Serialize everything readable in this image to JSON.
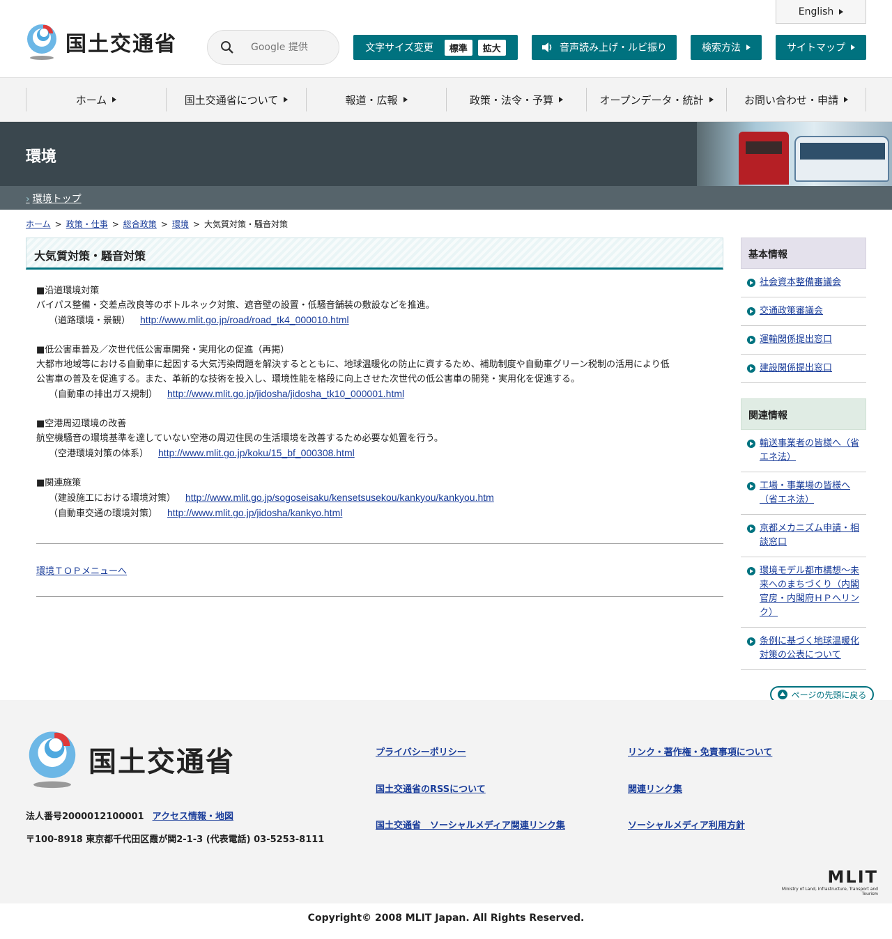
{
  "header": {
    "logo_text": "国土交通省",
    "search_placeholder": "Google 提供",
    "english_label": "English",
    "fontsize_label": "文字サイズ変更",
    "fontsize_standard": "標準",
    "fontsize_large": "拡大",
    "voice_label": "音声読み上げ・ルビ振り",
    "howto_label": "検索方法",
    "sitemap_label": "サイトマップ"
  },
  "gnav": [
    "ホーム",
    "国土交通省について",
    "報道・広報",
    "政策・法令・予算",
    "オープンデータ・統計",
    "お問い合わせ・申請"
  ],
  "banner": {
    "title": "環境",
    "subnav_link": "環境トップ"
  },
  "breadcrumb": [
    "ホーム",
    "政策・仕事",
    "総合政策",
    "環境"
  ],
  "breadcrumb_current": "大気質対策・騒音対策",
  "main": {
    "title": "大気質対策・騒音対策",
    "block1": {
      "heading": "■沿道環境対策",
      "text": "バイパス整備・交差点改良等のボトルネック対策、遮音壁の設置・低騒音舗装の敷設などを推進。",
      "ref_label": "（道路環境・景観）",
      "ref_url": "http://www.mlit.go.jp/road/road_tk4_000010.html"
    },
    "block2": {
      "heading": "■低公害車普及／次世代低公害車開発・実用化の促進（再掲）",
      "text1": "大都市地域等における自動車に起因する大気汚染問題を解決するとともに、地球温暖化の防止に資するため、補助制度や自動車グリーン税制の活用により低",
      "text2": "公害車の普及を促進する。また、革新的な技術を投入し、環境性能を格段に向上させた次世代の低公害車の開発・実用化を促進する。",
      "ref_label": "（自動車の排出ガス規制）",
      "ref_url": "http://www.mlit.go.jp/jidosha/jidosha_tk10_000001.html"
    },
    "block3": {
      "heading": "■空港周辺環境の改善",
      "text": "航空機騒音の環境基準を達していない空港の周辺住民の生活環境を改善するため必要な処置を行う。",
      "ref_label": "（空港環境対策の体系）",
      "ref_url": "http://www.mlit.go.jp/koku/15_bf_000308.html"
    },
    "block4": {
      "heading": "■関連施策",
      "ref1_label": "（建設施工における環境対策）",
      "ref1_url": "http://www.mlit.go.jp/sogoseisaku/kensetsusekou/kankyou/kankyou.htm",
      "ref2_label": "（自動車交通の環境対策）",
      "ref2_url": "http://www.mlit.go.jp/jidosha/kankyo.html"
    },
    "back_link": "環境ＴＯＰメニューへ"
  },
  "sidebar": {
    "basic_title": "基本情報",
    "basic_items": [
      "社会資本整備審議会",
      "交通政策審議会",
      "運輸関係提出窓口",
      "建設関係提出窓口"
    ],
    "related_title": "関連情報",
    "related_items": [
      "輸送事業者の皆様へ（省エネ法）",
      "工場・事業場の皆様へ（省エネ法）",
      "京都メカニズム申請・相談窓口",
      "環境モデル都市構想～未来へのまちづくり（内閣官房・内閣府ＨＰへリンク）",
      "条例に基づく地球温暖化対策の公表について"
    ]
  },
  "pagetop_label": "ページの先頭に戻る",
  "footer": {
    "logo_text": "国土交通省",
    "corp_number": "法人番号2000012100001",
    "access_link": "アクセス情報・地図",
    "address": "〒100-8918 東京都千代田区霞が関2-1-3 (代表電話) 03-5253-8111",
    "links": [
      "プライバシーポリシー",
      "リンク・著作権・免責事項について",
      "国土交通省のRSSについて",
      "関連リンク集",
      "国土交通省　ソーシャルメディア関連リンク集",
      "ソーシャルメディア利用方針"
    ],
    "mlit_logo": "MLIT",
    "mlit_sub": "Ministry of Land, Infrastructure, Transport and Tourism"
  },
  "copyright": "Copyright© 2008 MLIT Japan. All Rights Reserved.",
  "colors": {
    "accent": "#00727f",
    "banner": "#3a474e",
    "link": "#1a3d9a"
  }
}
